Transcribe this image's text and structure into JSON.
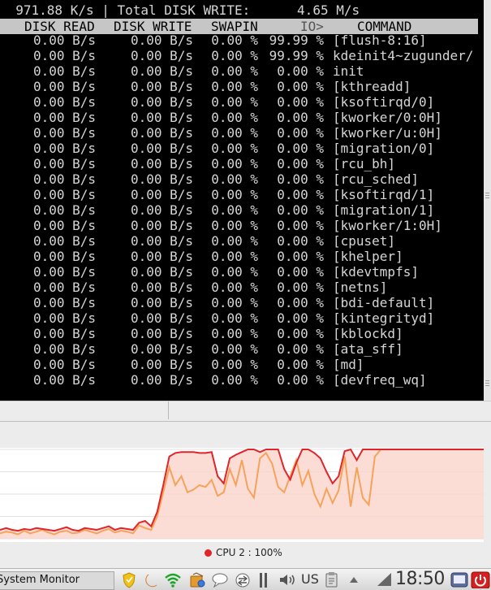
{
  "terminal": {
    "top_line_left": "  971.88 K/s | Total DISK WRITE:      4.65 M/s",
    "headers": {
      "disk_read": "DISK READ",
      "disk_write": "DISK WRITE",
      "swapin": "SWAPIN",
      "io": "IO>",
      "command": "COMMAND"
    },
    "rows": [
      {
        "read": "0.00 B/s",
        "write": "0.00 B/s",
        "swapin": "0.00 %",
        "io": "99.99 %",
        "command": "[flush-8:16]"
      },
      {
        "read": "0.00 B/s",
        "write": "0.00 B/s",
        "swapin": "0.00 %",
        "io": "99.99 %",
        "command": "kdeinit4~zugunder/"
      },
      {
        "read": "0.00 B/s",
        "write": "0.00 B/s",
        "swapin": "0.00 %",
        "io": "0.00 %",
        "command": "init"
      },
      {
        "read": "0.00 B/s",
        "write": "0.00 B/s",
        "swapin": "0.00 %",
        "io": "0.00 %",
        "command": "[kthreadd]"
      },
      {
        "read": "0.00 B/s",
        "write": "0.00 B/s",
        "swapin": "0.00 %",
        "io": "0.00 %",
        "command": "[ksoftirqd/0]"
      },
      {
        "read": "0.00 B/s",
        "write": "0.00 B/s",
        "swapin": "0.00 %",
        "io": "0.00 %",
        "command": "[kworker/0:0H]"
      },
      {
        "read": "0.00 B/s",
        "write": "0.00 B/s",
        "swapin": "0.00 %",
        "io": "0.00 %",
        "command": "[kworker/u:0H]"
      },
      {
        "read": "0.00 B/s",
        "write": "0.00 B/s",
        "swapin": "0.00 %",
        "io": "0.00 %",
        "command": "[migration/0]"
      },
      {
        "read": "0.00 B/s",
        "write": "0.00 B/s",
        "swapin": "0.00 %",
        "io": "0.00 %",
        "command": "[rcu_bh]"
      },
      {
        "read": "0.00 B/s",
        "write": "0.00 B/s",
        "swapin": "0.00 %",
        "io": "0.00 %",
        "command": "[rcu_sched]"
      },
      {
        "read": "0.00 B/s",
        "write": "0.00 B/s",
        "swapin": "0.00 %",
        "io": "0.00 %",
        "command": "[ksoftirqd/1]"
      },
      {
        "read": "0.00 B/s",
        "write": "0.00 B/s",
        "swapin": "0.00 %",
        "io": "0.00 %",
        "command": "[migration/1]"
      },
      {
        "read": "0.00 B/s",
        "write": "0.00 B/s",
        "swapin": "0.00 %",
        "io": "0.00 %",
        "command": "[kworker/1:0H]"
      },
      {
        "read": "0.00 B/s",
        "write": "0.00 B/s",
        "swapin": "0.00 %",
        "io": "0.00 %",
        "command": "[cpuset]"
      },
      {
        "read": "0.00 B/s",
        "write": "0.00 B/s",
        "swapin": "0.00 %",
        "io": "0.00 %",
        "command": "[khelper]"
      },
      {
        "read": "0.00 B/s",
        "write": "0.00 B/s",
        "swapin": "0.00 %",
        "io": "0.00 %",
        "command": "[kdevtmpfs]"
      },
      {
        "read": "0.00 B/s",
        "write": "0.00 B/s",
        "swapin": "0.00 %",
        "io": "0.00 %",
        "command": "[netns]"
      },
      {
        "read": "0.00 B/s",
        "write": "0.00 B/s",
        "swapin": "0.00 %",
        "io": "0.00 %",
        "command": "[bdi-default]"
      },
      {
        "read": "0.00 B/s",
        "write": "0.00 B/s",
        "swapin": "0.00 %",
        "io": "0.00 %",
        "command": "[kintegrityd]"
      },
      {
        "read": "0.00 B/s",
        "write": "0.00 B/s",
        "swapin": "0.00 %",
        "io": "0.00 %",
        "command": "[kblockd]"
      },
      {
        "read": "0.00 B/s",
        "write": "0.00 B/s",
        "swapin": "0.00 %",
        "io": "0.00 %",
        "command": "[ata_sff]"
      },
      {
        "read": "0.00 B/s",
        "write": "0.00 B/s",
        "swapin": "0.00 %",
        "io": "0.00 %",
        "command": "[md]"
      },
      {
        "read": "0.00 B/s",
        "write": "0.00 B/s",
        "swapin": "0.00 %",
        "io": "0.00 %",
        "command": "[devfreq_wq]"
      }
    ]
  },
  "cpu_graph": {
    "legend": "CPU 2 : 100%",
    "colors": {
      "cpu2": "#e0242a",
      "cpu1": "#f6a35a",
      "fill": "#f9d2c8"
    },
    "cpu2_series": [
      10,
      12,
      10,
      9,
      11,
      10,
      12,
      11,
      10,
      9,
      11,
      13,
      10,
      9,
      12,
      11,
      10,
      12,
      14,
      10,
      12,
      11,
      10,
      18,
      20,
      14,
      30,
      60,
      92,
      96,
      97,
      97,
      97,
      96,
      96,
      97,
      70,
      62,
      90,
      94,
      97,
      100,
      100,
      97,
      100,
      100,
      100,
      78,
      66,
      85,
      100,
      100,
      96,
      90,
      75,
      62,
      70,
      98,
      100,
      88,
      100,
      100,
      100,
      100,
      100,
      100,
      100,
      100,
      100,
      100,
      100,
      100,
      100,
      100,
      100,
      100,
      100,
      100,
      100,
      100,
      100
    ],
    "cpu1_series": [
      6,
      8,
      7,
      5,
      9,
      6,
      8,
      10,
      7,
      5,
      8,
      9,
      6,
      7,
      10,
      8,
      6,
      9,
      11,
      7,
      9,
      8,
      6,
      15,
      12,
      10,
      25,
      52,
      80,
      60,
      70,
      52,
      55,
      60,
      58,
      66,
      48,
      52,
      78,
      60,
      88,
      56,
      46,
      90,
      96,
      84,
      58,
      52,
      70,
      88,
      60,
      76,
      50,
      36,
      56,
      40,
      54,
      92,
      36,
      80,
      46,
      38,
      92,
      100,
      100,
      100,
      100,
      100,
      100,
      100,
      100,
      100,
      100,
      100,
      100,
      100,
      100,
      100,
      100,
      100,
      100
    ]
  },
  "taskbar": {
    "task_label": "System Monitor",
    "keyboard": "US",
    "clock": "18:50"
  }
}
